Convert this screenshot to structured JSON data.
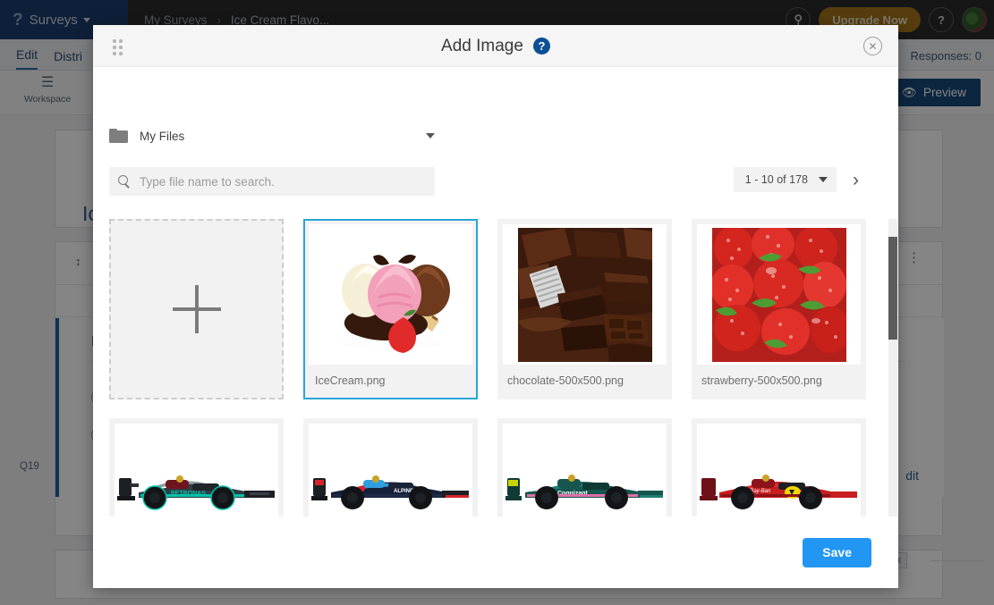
{
  "app": {
    "brand": {
      "logo_glyph": "?",
      "name": "Surveys",
      "caret_icon": "chevron-down-icon"
    },
    "breadcrumb": {
      "root": "My Surveys",
      "separator": "›",
      "current": "Ice Cream Flavo..."
    },
    "top_actions": {
      "search_icon": "search-icon",
      "upgrade_label": "Upgrade Now",
      "help_label": "?",
      "avatar_icon": "avatar"
    },
    "subnav": {
      "items": [
        "Edit",
        "Distri"
      ],
      "selected": "Edit",
      "responses_label": "Responses: 0"
    },
    "toolbar": {
      "workspace_label": "Workspace",
      "workspace_icon": "workspace-icon",
      "preview_label": "Preview",
      "preview_icon": "eye-icon"
    },
    "canvas": {
      "survey_title_fragment": "Ic",
      "block_collapse_icon": "collapse-icon",
      "block_menu_icon": "kebab-menu-icon",
      "question_number": "Q19",
      "question_text_fragment": "D",
      "edit_link": "dit",
      "lock_label": "ock"
    }
  },
  "modal": {
    "title": "Add Image",
    "help_icon": "help-icon",
    "close_icon": "close-icon",
    "drag_handle_icon": "drag-handle-icon",
    "folder": {
      "icon": "folder-icon",
      "label": "My Files",
      "caret_icon": "chevron-down-icon"
    },
    "search": {
      "icon": "search-icon",
      "placeholder": "Type file name to search.",
      "value": ""
    },
    "pager": {
      "range_label": "1 - 10 of 178",
      "caret_icon": "chevron-down-icon",
      "next_icon": "chevron-right-icon"
    },
    "upload_tile": {
      "icon": "plus-icon",
      "label": ""
    },
    "files": [
      {
        "name": "IceCream.png",
        "thumb": "icecream",
        "selected": true
      },
      {
        "name": "chocolate-500x500.png",
        "thumb": "chocolate",
        "selected": false
      },
      {
        "name": "strawberry-500x500.png",
        "thumb": "strawberry",
        "selected": false
      },
      {
        "name": "",
        "thumb": "f1-mercedes",
        "selected": false
      },
      {
        "name": "",
        "thumb": "f1-alpine",
        "selected": false
      },
      {
        "name": "",
        "thumb": "f1-astonmartin",
        "selected": false
      },
      {
        "name": "",
        "thumb": "f1-ferrari",
        "selected": false
      }
    ],
    "footer": {
      "save_label": "Save"
    },
    "colors": {
      "selection_border": "#2ba6d8",
      "save_button": "#2196f3",
      "help_badge": "#0b4f94",
      "header_bg": "#f5f5f5"
    }
  }
}
